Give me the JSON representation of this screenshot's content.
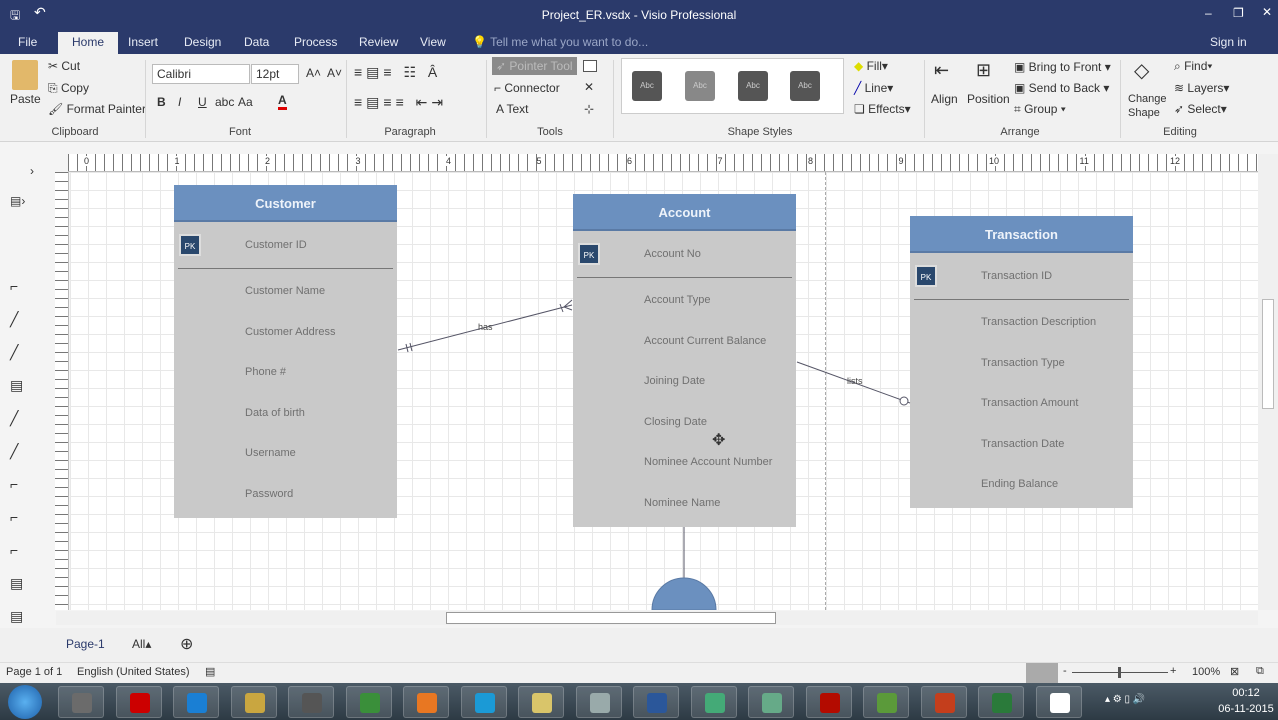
{
  "window": {
    "title": "Project_ER.vsdx - Visio Professional",
    "sign_in": "Sign in"
  },
  "tabs": [
    "File",
    "Home",
    "Insert",
    "Design",
    "Data",
    "Process",
    "Review",
    "View"
  ],
  "tell_me": "Tell me what you want to do...",
  "ribbon": {
    "clipboard": {
      "paste": "Paste",
      "cut": "Cut",
      "copy": "Copy",
      "format_painter": "Format Painter",
      "label": "Clipboard"
    },
    "font": {
      "family": "Calibri",
      "size": "12pt",
      "label": "Font",
      "bold": "B",
      "italic": "I",
      "underline": "U",
      "strike": "abc",
      "case": "Aa"
    },
    "paragraph": {
      "label": "Paragraph"
    },
    "tools": {
      "pointer": "Pointer Tool",
      "connector": "Connector",
      "text": "Text",
      "label": "Tools"
    },
    "shape_styles": {
      "label": "Shape Styles",
      "swatch": "Abc",
      "fill": "Fill",
      "line": "Line",
      "effects": "Effects"
    },
    "arrange": {
      "align": "Align",
      "position": "Position",
      "bring_front": "Bring to Front",
      "send_back": "Send to Back",
      "group": "Group",
      "label": "Arrange"
    },
    "editing": {
      "change_shape_1": "Change",
      "change_shape_2": "Shape",
      "find": "Find",
      "layers": "Layers",
      "select": "Select",
      "label": "Editing"
    }
  },
  "ruler_marks": [
    "0",
    "1",
    "2",
    "3",
    "4",
    "5",
    "6",
    "7",
    "8",
    "9",
    "10",
    "11",
    "12"
  ],
  "entities": [
    {
      "name": "Customer",
      "pk_badge": "PK",
      "pk": "Customer ID",
      "attrs": [
        "Customer Name",
        "Customer Address",
        "Phone #",
        "Data of birth",
        "Username",
        "Password"
      ]
    },
    {
      "name": "Account",
      "pk_badge": "PK",
      "pk": "Account No",
      "attrs": [
        "Account Type",
        "Account Current Balance",
        "Joining Date",
        "Closing Date",
        "Nominee Account Number",
        "Nominee  Name"
      ]
    },
    {
      "name": "Transaction",
      "pk_badge": "PK",
      "pk": "Transaction ID",
      "attrs": [
        "Transaction Description",
        "Transaction Type",
        "Transaction Amount",
        "Transaction Date",
        "Ending Balance"
      ]
    }
  ],
  "relations": {
    "has": "has",
    "lists": "lists"
  },
  "pages": {
    "page1": "Page-1",
    "all": "All"
  },
  "status": {
    "page": "Page 1 of 1",
    "language": "English (United States)",
    "zoom": "100%"
  },
  "clock": {
    "time": "00:12",
    "date": "06-11-2015"
  },
  "colors": {
    "titlebar": "#2b3a6b",
    "entity_header": "#6b90bf",
    "entity_body": "#c9c9c9",
    "pk": "#2a486d"
  }
}
